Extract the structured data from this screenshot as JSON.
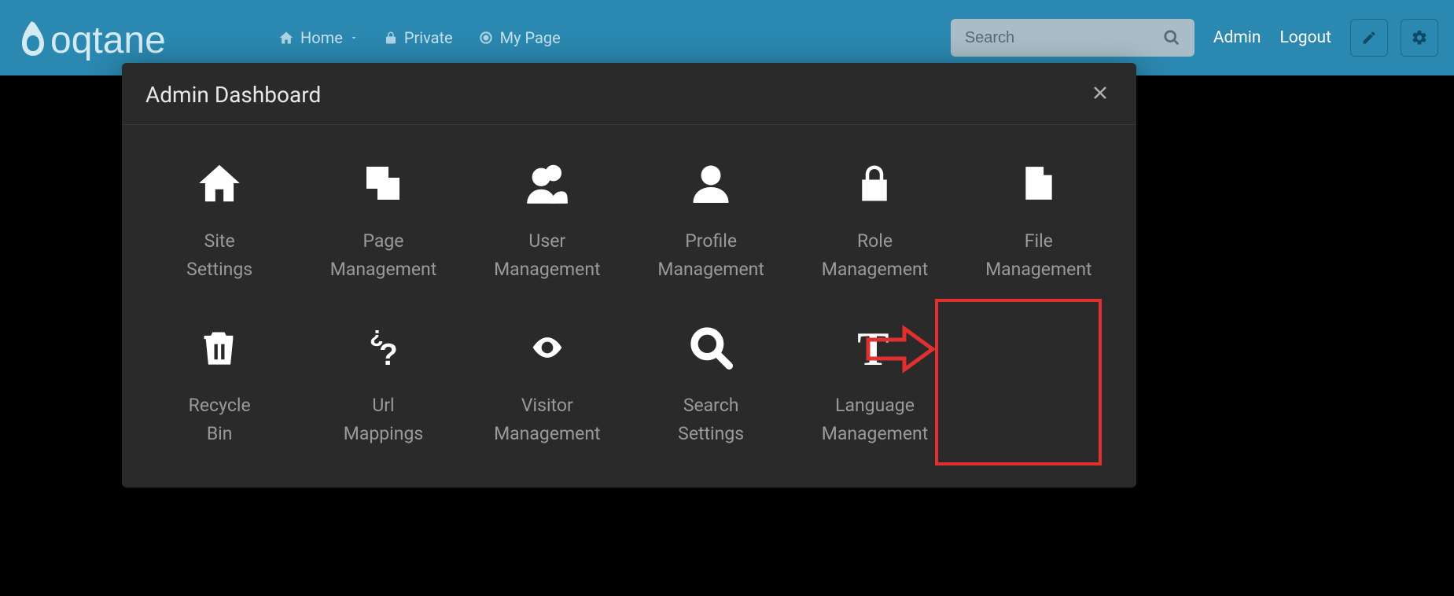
{
  "nav": {
    "home": "Home",
    "private": "Private",
    "mypage": "My Page"
  },
  "search": {
    "placeholder": "Search"
  },
  "top": {
    "admin": "Admin",
    "logout": "Logout"
  },
  "modal": {
    "title": "Admin Dashboard",
    "tiles": [
      {
        "label": "Site\nSettings"
      },
      {
        "label": "Page\nManagement"
      },
      {
        "label": "User\nManagement"
      },
      {
        "label": "Profile\nManagement"
      },
      {
        "label": "Role\nManagement"
      },
      {
        "label": "File\nManagement"
      },
      {
        "label": "Recycle\nBin"
      },
      {
        "label": "Url\nMappings"
      },
      {
        "label": "Visitor\nManagement"
      },
      {
        "label": "Search\nSettings"
      },
      {
        "label": "Language\nManagement"
      }
    ]
  }
}
